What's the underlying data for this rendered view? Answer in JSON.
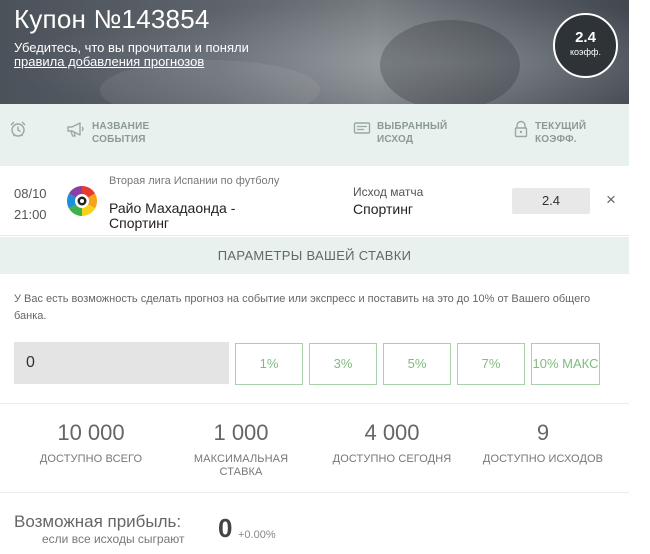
{
  "header": {
    "title": "Купон №143854",
    "subtitle": "Убедитесь, что вы прочитали и поняли",
    "rules_link": "правила добавления прогнозов",
    "odds_value": "2.4",
    "odds_label": "коэфф."
  },
  "columns": {
    "event_name_line1": "НАЗВАНИЕ",
    "event_name_line2": "СОБЫТИЯ",
    "outcome_line1": "ВЫБРАННЫЙ",
    "outcome_line2": "ИСХОД",
    "odds_line1": "ТЕКУЩИЙ",
    "odds_line2": "КОЭФФ.",
    "icons": [
      "alarm-clock-icon",
      "megaphone-icon",
      "ticket-icon",
      "lock-icon"
    ]
  },
  "event": {
    "date": "08/10",
    "time": "21:00",
    "league": "Вторая лига Испании по футболу",
    "name": "Райо Махадаонда - Спортинг",
    "outcome_label": "Исход матча",
    "outcome": "Спортинг",
    "odds": "2.4",
    "close": "×",
    "logo_icon": "la-liga-logo-icon"
  },
  "params": {
    "title": "ПАРАМЕТРЫ ВАШЕЙ СТАВКИ",
    "info": "У Вас есть возможность сделать прогноз на событие или экспресс и поставить на это до 10% от Вашего общего банка.",
    "amount": "0",
    "buttons": [
      "1%",
      "3%",
      "5%",
      "7%",
      "10% МАКС"
    ]
  },
  "stats": [
    {
      "value": "10 000",
      "label_line1": "ДОСТУПНО ВСЕГО",
      "label_line2": ""
    },
    {
      "value": "1 000",
      "label_line1": "МАКСИМАЛЬНАЯ",
      "label_line2": "СТАВКА"
    },
    {
      "value": "4 000",
      "label_line1": "ДОСТУПНО СЕГОДНЯ",
      "label_line2": ""
    },
    {
      "value": "9",
      "label_line1": "ДОСТУПНО ИСХОДОВ",
      "label_line2": ""
    }
  ],
  "profit": {
    "title": "Возможная прибыль:",
    "subtitle": "если все исходы сыграют",
    "value": "0",
    "percent": "+0.00%"
  },
  "colors": {
    "accent_green": "#7fbd7d",
    "light_panel": "#e9f1ef"
  }
}
